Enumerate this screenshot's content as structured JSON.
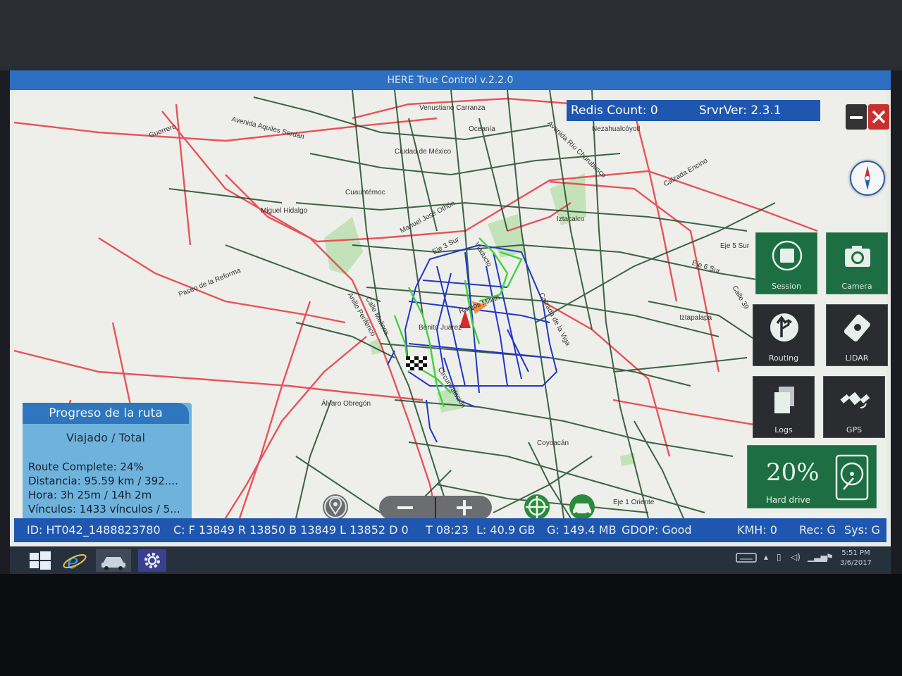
{
  "window": {
    "title": "HERE True Control v.2.2.0"
  },
  "server_bar": {
    "redis_count": "Redis Count: 0",
    "server_version": "SrvrVer: 2.3.1"
  },
  "map_labels": [
    "Venustiano Carranza",
    "Oceanía",
    "Guerrero",
    "Avenida Aquiles Serdán",
    "Ciudad de México",
    "Avenida Río Churubusco",
    "Nezahualcóyotl",
    "Calzada Encino",
    "Cuauhtémoc",
    "Miguel Hidalgo",
    "Manuel José Othón",
    "Iztacalco",
    "Eje 3 Sur",
    "Viaducto",
    "Eje 5 Sur",
    "Eje 6 Sur",
    "Calle 39",
    "Paseo de la Reforma",
    "Anillo Periférico",
    "Calle Molinos",
    "Ramos Millán",
    "Calzada de la Viga",
    "Benito Juárez",
    "Iztapalapa",
    "Circunvalación",
    "Álvaro Obregón",
    "Coyoacán",
    "Eje 1 Oriente"
  ],
  "tiles": {
    "session": "Session",
    "camera": "Camera",
    "routing": "Routing",
    "lidar": "LIDAR",
    "logs": "Logs",
    "gps": "GPS"
  },
  "storage": {
    "percent": "20%",
    "label": "Hard drive",
    "fill_fraction": 0.2
  },
  "progress": {
    "title": "Progreso de la ruta",
    "subtitle": "Viajado / Total",
    "route_complete": "Route Complete: 24%",
    "distance": "Distancia: 95.59 km / 392....",
    "hora": "Hora: 3h 25m / 14h 2m",
    "vinculos": "Vínculos: 1433 vínculos / 5..."
  },
  "status": {
    "id": "ID: HT042_1488823780",
    "counters": "C: F 13849 R 13850 B 13849 L 13852 D 0",
    "time": "T 08:23",
    "local_storage": "L:  40.9 GB",
    "gps_storage": "G: 149.4 MB",
    "gdop": "GDOP: Good",
    "kmh": "KMH: 0",
    "rec": "Rec: G",
    "sys": "Sys: G"
  },
  "taskbar": {
    "time": "5:51 PM",
    "date": "3/6/2017"
  },
  "colors": {
    "title_blue": "#2d6fc2",
    "status_blue": "#1f57b0",
    "tile_green": "#1d6e43",
    "road_dark": "#1d4a2a",
    "road_red": "#e8424b",
    "route_blue": "#2136c8",
    "route_green": "#3fd23a"
  }
}
